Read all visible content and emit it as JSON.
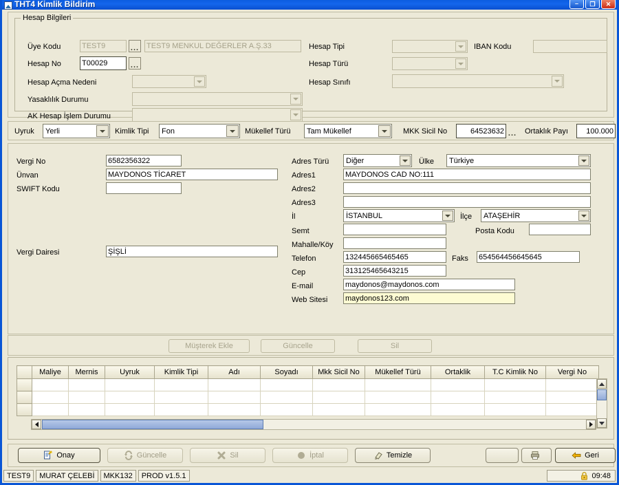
{
  "window": {
    "title": "THT4 Kimlik Bildirim",
    "icon": "app-icon",
    "buttons": {
      "minimize": "–",
      "maximize": "❐",
      "close": "✕"
    }
  },
  "account_group": {
    "legend": "Hesap Bilgileri",
    "uye_kodu_label": "Üye Kodu",
    "uye_kodu_value": "TEST9",
    "uye_adi_value": "TEST9 MENKUL DEĞERLER A.Ş.33",
    "hesap_no_label": "Hesap No",
    "hesap_no_value": "T00029",
    "hesap_acma_nedeni_label": "Hesap Açma Nedeni",
    "hesap_acma_nedeni_value": "",
    "yasaklilik_label": "Yasaklılık Durumu",
    "yasaklilik_value": "",
    "ak_hesap_label": "AK Hesap İşlem Durumu",
    "ak_hesap_value": "",
    "hesap_tipi_label": "Hesap Tipi",
    "hesap_tipi_value": "",
    "hesap_turu_label": "Hesap Türü",
    "hesap_turu_value": "",
    "hesap_sinifi_label": "Hesap Sınıfı",
    "hesap_sinifi_value": "",
    "iban_label": "IBAN Kodu",
    "iban_value": "",
    "ellipsis_label": "..."
  },
  "identity_bar": {
    "uyruk_label": "Uyruk",
    "uyruk_value": "Yerli",
    "kimlik_tipi_label": "Kimlik Tipi",
    "kimlik_tipi_value": "Fon",
    "mukellef_turu_label": "Mükellef Türü",
    "mukellef_turu_value": "Tam Mükellef",
    "mkk_sicil_label": "MKK Sicil No",
    "mkk_sicil_value": "64523632",
    "ortaklik_payi_label": "Ortaklık Payı",
    "ortaklik_payi_value": "100.000",
    "ellipsis_label": "..."
  },
  "detail_left": {
    "vergi_no_label": "Vergi No",
    "vergi_no_value": "6582356322",
    "unvan_label": "Ünvan",
    "unvan_value": "MAYDONOS TİCARET",
    "swift_label": "SWIFT Kodu",
    "swift_value": "",
    "vergi_dairesi_label": "Vergi Dairesi",
    "vergi_dairesi_value": "ŞİŞLİ"
  },
  "detail_right": {
    "adres_turu_label": "Adres Türü",
    "adres_turu_value": "Diğer",
    "ulke_label": "Ülke",
    "ulke_value": "Türkiye",
    "adres1_label": "Adres1",
    "adres1_value": "MAYDONOS CAD NO:111",
    "adres2_label": "Adres2",
    "adres2_value": "",
    "adres3_label": "Adres3",
    "adres3_value": "",
    "il_label": "İl",
    "il_value": "İSTANBUL",
    "ilce_label": "İlçe",
    "ilce_value": "ATAŞEHİR",
    "semt_label": "Semt",
    "semt_value": "",
    "posta_kodu_label": "Posta Kodu",
    "posta_kodu_value": "",
    "mahalle_label": "Mahalle/Köy",
    "mahalle_value": "",
    "telefon_label": "Telefon",
    "telefon_value": "132445665465465",
    "faks_label": "Faks",
    "faks_value": "654564456645645",
    "cep_label": "Cep",
    "cep_value": "313125465643215",
    "email_label": "E-mail",
    "email_value": "maydonos@maydonos.com",
    "web_label": "Web Sitesi",
    "web_value": "maydonos123.com"
  },
  "mid_buttons": [
    {
      "label": "Müşterek Ekle",
      "enabled": false
    },
    {
      "label": "Güncelle",
      "enabled": false
    },
    {
      "label": "Sil",
      "enabled": false
    }
  ],
  "grid": {
    "columns": [
      "Maliye",
      "Mernis",
      "Uyruk",
      "Kimlik Tipi",
      "Adı",
      "Soyadı",
      "Mkk Sicil No",
      "Mükellef Türü",
      "Ortaklik",
      "T.C Kimlik No",
      "Vergi No"
    ],
    "rows": [
      [],
      [],
      []
    ]
  },
  "toolbar": [
    {
      "label": "Onay",
      "icon": "document-check-icon",
      "enabled": true
    },
    {
      "label": "Güncelle",
      "icon": "refresh-icon",
      "enabled": false
    },
    {
      "label": "Sil",
      "icon": "delete-x-icon",
      "enabled": false
    },
    {
      "label": "İptal",
      "icon": "cancel-circle-icon",
      "enabled": false
    },
    {
      "label": "Temizle",
      "icon": "eraser-icon",
      "enabled": true
    },
    {
      "label": "",
      "icon": "blank-icon",
      "enabled": true
    },
    {
      "label": "",
      "icon": "printer-icon",
      "enabled": true
    },
    {
      "label": "Geri",
      "icon": "back-arrow-icon",
      "enabled": true
    }
  ],
  "status": {
    "cells": [
      "TEST9",
      "MURAT ÇELEBİ",
      "MKK132",
      "PROD v1.5.1"
    ],
    "lock_icon": "lock-icon",
    "time": "09:48"
  },
  "colors": {
    "titlebar": "#0b5ce0",
    "window_bg": "#ece9d8",
    "focus_field": "#fdfbd3",
    "scroll_thumb": "#8fa9d8"
  }
}
